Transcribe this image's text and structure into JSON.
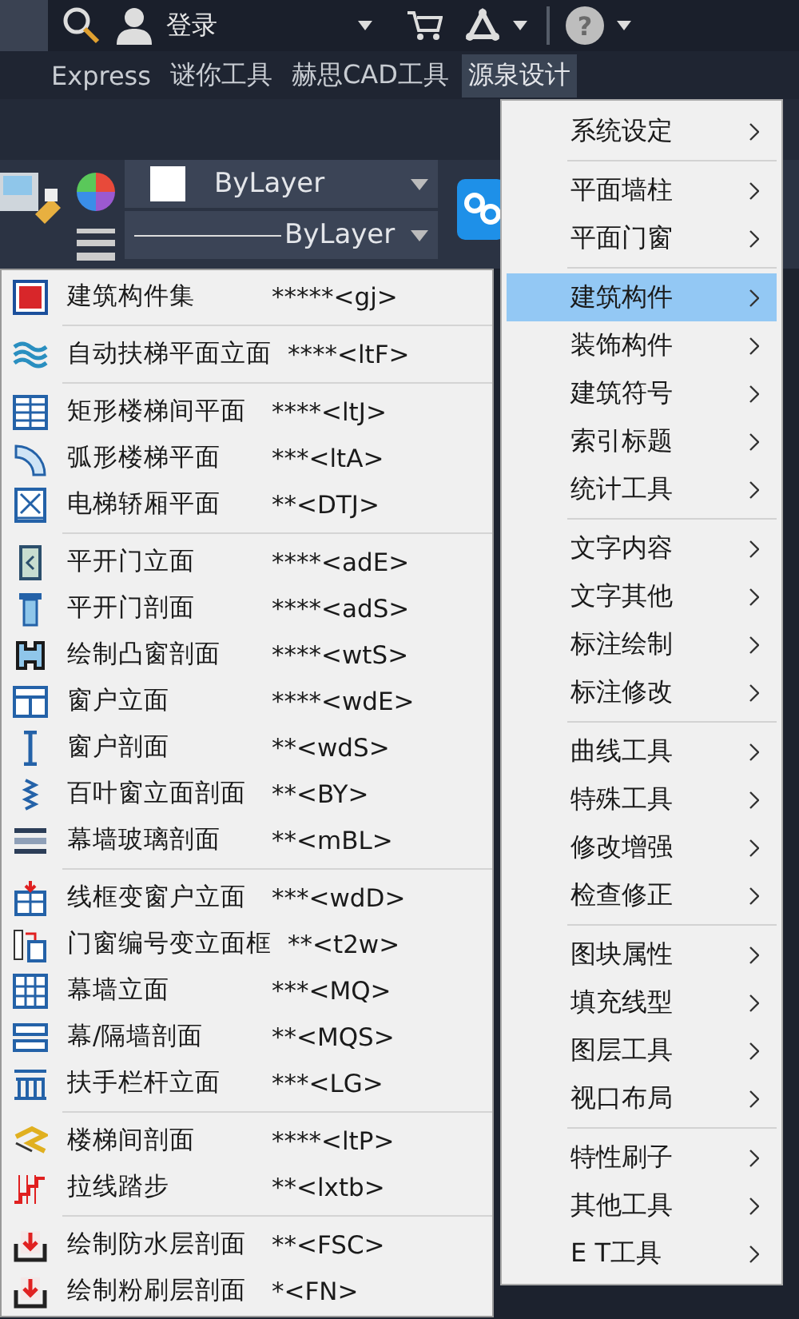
{
  "top_bar": {
    "login": "登录",
    "help": "?"
  },
  "menu_bar": [
    {
      "label": "Express",
      "selected": false
    },
    {
      "label": "谜你工具",
      "selected": false
    },
    {
      "label": "赫思CAD工具",
      "selected": false
    },
    {
      "label": "源泉设计",
      "selected": true
    }
  ],
  "ribbon": {
    "color_combo": "ByLayer",
    "linetype_combo": "ByLayer"
  },
  "main_menu": {
    "groups": [
      [
        {
          "label": "系统设定",
          "selected": false,
          "has_submenu": true
        }
      ],
      [
        {
          "label": "平面墙柱",
          "selected": false,
          "has_submenu": true
        },
        {
          "label": "平面门窗",
          "selected": false,
          "has_submenu": true
        }
      ],
      [
        {
          "label": "建筑构件",
          "selected": true,
          "has_submenu": true
        },
        {
          "label": "装饰构件",
          "selected": false,
          "has_submenu": true
        },
        {
          "label": "建筑符号",
          "selected": false,
          "has_submenu": true
        },
        {
          "label": "索引标题",
          "selected": false,
          "has_submenu": true
        },
        {
          "label": "统计工具",
          "selected": false,
          "has_submenu": true
        }
      ],
      [
        {
          "label": "文字内容",
          "selected": false,
          "has_submenu": true
        },
        {
          "label": "文字其他",
          "selected": false,
          "has_submenu": true
        },
        {
          "label": "标注绘制",
          "selected": false,
          "has_submenu": true
        },
        {
          "label": "标注修改",
          "selected": false,
          "has_submenu": true
        }
      ],
      [
        {
          "label": "曲线工具",
          "selected": false,
          "has_submenu": true
        },
        {
          "label": "特殊工具",
          "selected": false,
          "has_submenu": true
        },
        {
          "label": "修改增强",
          "selected": false,
          "has_submenu": true
        },
        {
          "label": "检查修正",
          "selected": false,
          "has_submenu": true
        }
      ],
      [
        {
          "label": "图块属性",
          "selected": false,
          "has_submenu": true
        },
        {
          "label": "填充线型",
          "selected": false,
          "has_submenu": true
        },
        {
          "label": "图层工具",
          "selected": false,
          "has_submenu": true
        },
        {
          "label": "视口布局",
          "selected": false,
          "has_submenu": true
        }
      ],
      [
        {
          "label": "特性刷子",
          "selected": false,
          "has_submenu": true
        },
        {
          "label": "其他工具",
          "selected": false,
          "has_submenu": true
        },
        {
          "label": "E T工具",
          "selected": false,
          "has_submenu": true
        }
      ]
    ]
  },
  "submenu": {
    "groups": [
      [
        {
          "label": "建筑构件集",
          "shortcut": "*****<gj>"
        }
      ],
      [
        {
          "label": "自动扶梯平面立面",
          "shortcut": "****<ltF>"
        }
      ],
      [
        {
          "label": "矩形楼梯间平面",
          "shortcut": "****<ltJ>"
        },
        {
          "label": "弧形楼梯平面",
          "shortcut": "***<ltA>"
        },
        {
          "label": "电梯轿厢平面",
          "shortcut": "**<DTJ>"
        }
      ],
      [
        {
          "label": "平开门立面",
          "shortcut": "****<adE>"
        },
        {
          "label": "平开门剖面",
          "shortcut": "****<adS>"
        },
        {
          "label": "绘制凸窗剖面",
          "shortcut": "****<wtS>"
        },
        {
          "label": "窗户立面",
          "shortcut": "****<wdE>"
        },
        {
          "label": "窗户剖面",
          "shortcut": "**<wdS>"
        },
        {
          "label": "百叶窗立面剖面",
          "shortcut": "**<BY>"
        },
        {
          "label": "幕墙玻璃剖面",
          "shortcut": "**<mBL>"
        }
      ],
      [
        {
          "label": "线框变窗户立面",
          "shortcut": "***<wdD>"
        },
        {
          "label": "门窗编号变立面框",
          "shortcut": "**<t2w>"
        },
        {
          "label": "幕墙立面",
          "shortcut": "***<MQ>"
        },
        {
          "label": "幕/隔墙剖面",
          "shortcut": "**<MQS>"
        },
        {
          "label": "扶手栏杆立面",
          "shortcut": "***<LG>"
        }
      ],
      [
        {
          "label": "楼梯间剖面",
          "shortcut": "****<ltP>"
        },
        {
          "label": "拉线踏步",
          "shortcut": "**<lxtb>"
        }
      ],
      [
        {
          "label": "绘制防水层剖面",
          "shortcut": "**<FSC>"
        },
        {
          "label": "绘制粉刷层剖面",
          "shortcut": "*<FN>"
        }
      ]
    ]
  }
}
